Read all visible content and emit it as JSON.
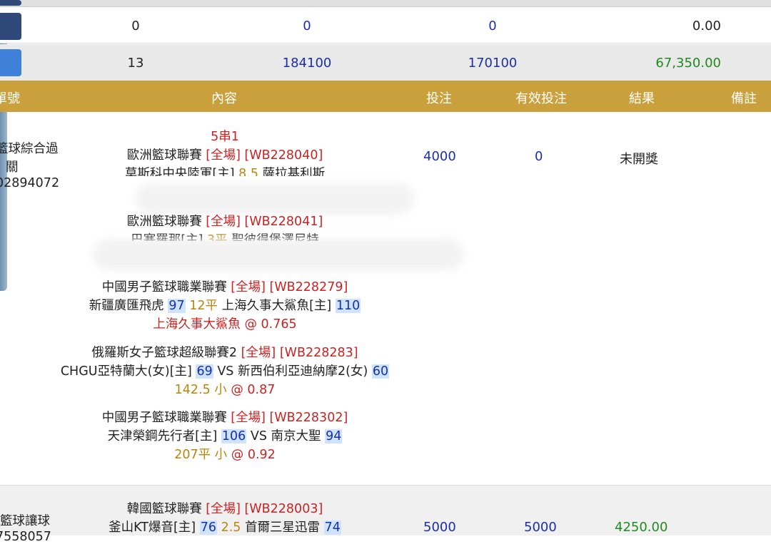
{
  "summary": [
    {
      "count": "0",
      "bet": "0",
      "effective": "0",
      "result": "0.00"
    },
    {
      "count": "13",
      "bet": "184100",
      "effective": "170100",
      "result": "67,350.00"
    }
  ],
  "header": {
    "col_id": "單號",
    "col_content": "內容",
    "col_bet": "投注",
    "col_effective": "有效投注",
    "col_result": "結果",
    "col_note": "備註"
  },
  "order1": {
    "type_line1": "籃球綜合過",
    "type_line2": "關",
    "order_no": "02894072",
    "combo": "5串1",
    "bet": "4000",
    "effective": "0",
    "result": "未開獎",
    "legs": [
      {
        "league": "歐洲籃球聯賽",
        "scope": "[全場]",
        "code": "[WB228040]",
        "home": "莫斯科中央陸軍[主]",
        "line": "8.5",
        "away": "薩拉基利斯"
      },
      {
        "league": "歐洲籃球聯賽",
        "scope": "[全場]",
        "code": "[WB228041]",
        "home": "巴塞羅那[主]",
        "line": "3平",
        "away": "聖彼得堡澤尼特"
      },
      {
        "league": "中國男子籃球職業聯賽",
        "scope": "[全場]",
        "code": "[WB228279]",
        "home": "新疆廣匯飛虎",
        "home_score": "97",
        "line": "12平",
        "away": "上海久事大鯊魚[主]",
        "away_score": "110",
        "pick": "上海久事大鯊魚",
        "odds": "@ 0.765"
      },
      {
        "league": "俄羅斯女子籃球超級聯賽2",
        "scope": "[全場]",
        "code": "[WB228283]",
        "home": "CHGU亞特蘭大(女)[主]",
        "home_score": "69",
        "vs": "VS",
        "away": "新西伯利亞迪納摩2(女)",
        "away_score": "60",
        "pick_line": "142.5 小",
        "odds": "@ 0.87"
      },
      {
        "league": "中國男子籃球職業聯賽",
        "scope": "[全場]",
        "code": "[WB228302]",
        "home": "天津榮鋼先行者[主]",
        "home_score": "106",
        "vs": "VS",
        "away": "南京大聖",
        "away_score": "94",
        "pick_line": "207平 小",
        "odds": "@ 0.92"
      }
    ]
  },
  "order2": {
    "type_line1": "籃球讓球",
    "order_no": "7558057",
    "bet": "5000",
    "effective": "5000",
    "result": "4250.00",
    "leg": {
      "league": "韓國籃球聯賽",
      "scope": "[全場]",
      "code": "[WB228003]",
      "home": "釜山KT爆音[主]",
      "home_score": "76",
      "line": "2.5",
      "away": "首爾三星迅雷",
      "away_score": "74"
    }
  },
  "colors": {
    "header_bg": "#c9a03c",
    "summary_bg": "#e9e9e9",
    "nav_dark": "#2f4a7a",
    "nav_light": "#3f80d8"
  }
}
